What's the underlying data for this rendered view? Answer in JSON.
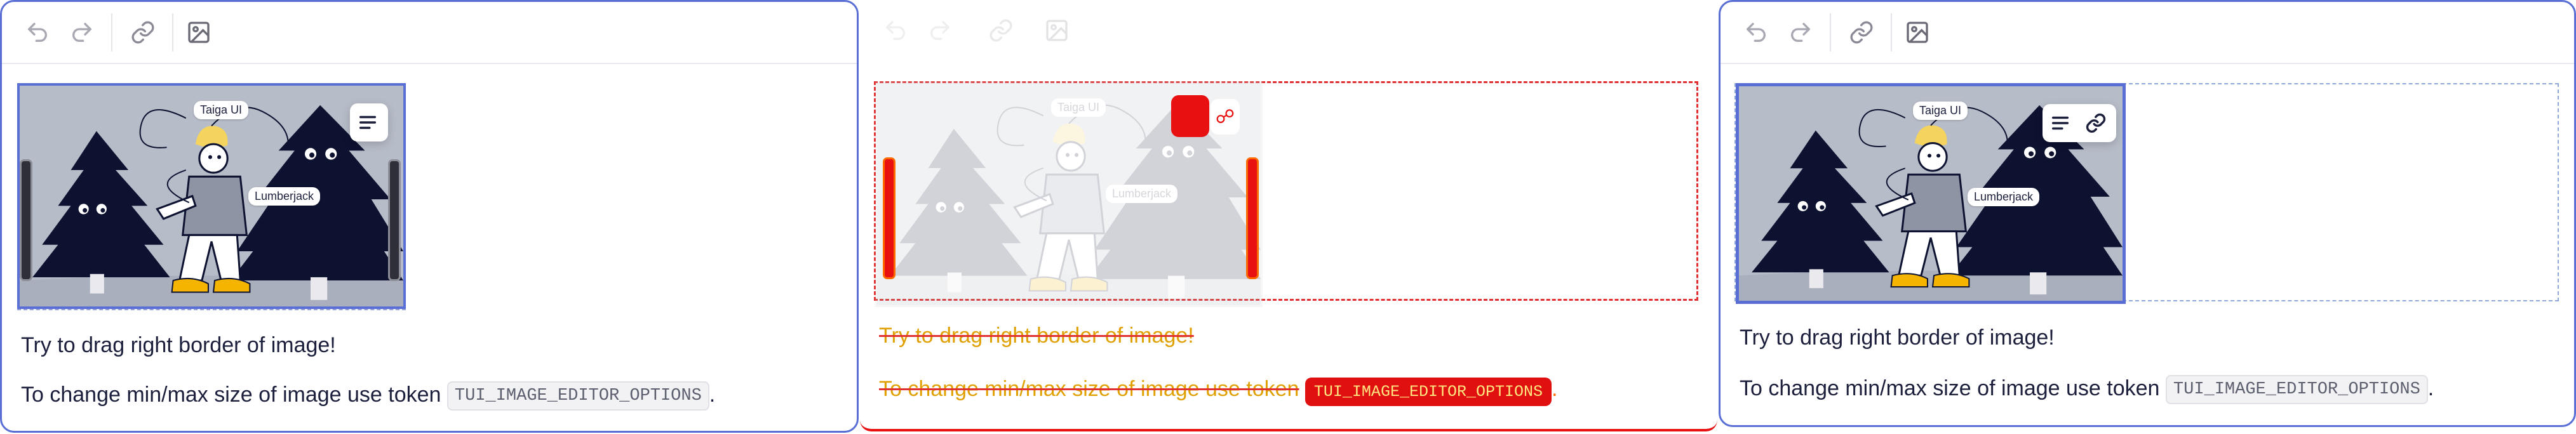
{
  "panels": [
    {
      "id": "p1",
      "label_1": "Taiga UI",
      "label_2": "Lumberjack",
      "line1": "Try to drag right border of image!",
      "line2_prefix": "To change min/max size of image use token",
      "line2_token": "TUI_IMAGE_EDITOR_OPTIONS",
      "line2_suffix": "."
    },
    {
      "id": "p2",
      "label_1": "Taiga UI",
      "label_2": "Lumberjack",
      "line1": "Try to drag right border of image!",
      "line2_prefix": "To change min/max size of image use token",
      "line2_token": "TUI_IMAGE_EDITOR_OPTIONS",
      "line2_suffix": "."
    },
    {
      "id": "p3",
      "label_1": "Taiga UI",
      "label_2": "Lumberjack",
      "line1": "Try to drag right border of image!",
      "line2_prefix": "To change min/max size of image use token",
      "line2_token": "TUI_IMAGE_EDITOR_OPTIONS",
      "line2_suffix": "."
    }
  ],
  "toolbar_icons": [
    "undo-icon",
    "redo-icon",
    "link-icon",
    "image-icon"
  ],
  "colors": {
    "accent": "#5a6fd6",
    "image_bg": "#b6bcc8",
    "tree": "#0c1230",
    "error_red": "#e03030",
    "warning_orange": "#ff6a00"
  }
}
